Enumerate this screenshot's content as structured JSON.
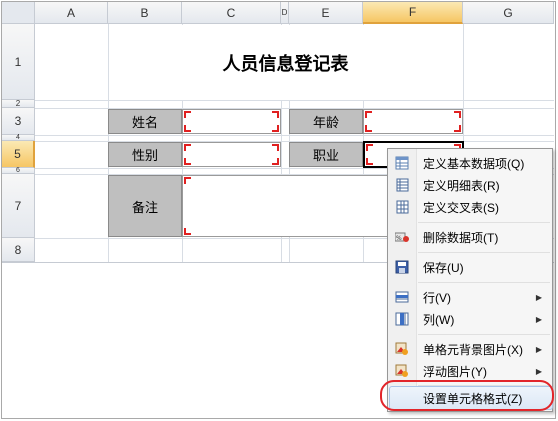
{
  "columns": [
    "A",
    "B",
    "C",
    "D",
    "E",
    "F",
    "G"
  ],
  "rows": [
    "1",
    "2",
    "3",
    "4",
    "5",
    "6",
    "7",
    "8"
  ],
  "sheet": {
    "title": "人员信息登记表",
    "labels": {
      "name": "姓名",
      "age": "年龄",
      "gender": "性别",
      "job": "职业",
      "remark": "备注"
    }
  },
  "context_menu": {
    "items": [
      {
        "label": "定义基本数据项(Q)",
        "icon": "table-icon"
      },
      {
        "label": "定义明细表(R)",
        "icon": "detail-table-icon"
      },
      {
        "label": "定义交叉表(S)",
        "icon": "cross-table-icon"
      },
      {
        "label": "删除数据项(T)",
        "icon": "delete-data-icon"
      },
      {
        "label": "保存(U)",
        "icon": "save-icon"
      },
      {
        "label": "行(V)",
        "icon": "row-icon",
        "submenu": true
      },
      {
        "label": "列(W)",
        "icon": "column-icon",
        "submenu": true
      },
      {
        "label": "单格元背景图片(X)",
        "icon": "background-image-icon",
        "submenu": true
      },
      {
        "label": "浮动图片(Y)",
        "icon": "float-image-icon",
        "submenu": true
      },
      {
        "label": "设置单元格格式(Z)",
        "icon": "",
        "highlighted": true
      }
    ]
  },
  "colors": {
    "selected_header": "#f6c664",
    "label_bg": "#bfbfbf",
    "marker": "#e02020",
    "highlight_ring": "#e2252a"
  }
}
